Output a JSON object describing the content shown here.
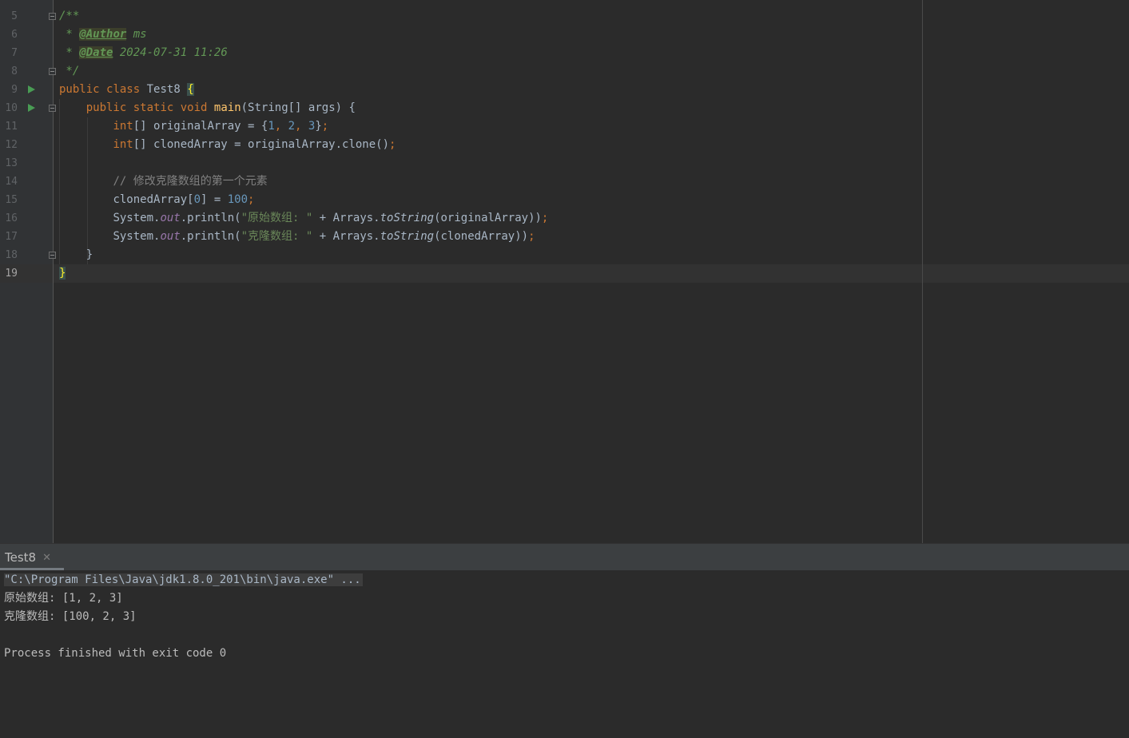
{
  "editor": {
    "line_numbers": [
      "5",
      "6",
      "7",
      "8",
      "9",
      "10",
      "11",
      "12",
      "13",
      "14",
      "15",
      "16",
      "17",
      "18",
      "19"
    ],
    "current_line": "19",
    "javadoc": {
      "open": "/**",
      "star": " * ",
      "author_tag": "@Author",
      "author_value": " ms",
      "date_tag": "@Date",
      "date_value": " 2024-07-31 11:26",
      "close": " */"
    },
    "class_decl": {
      "kw_public": "public",
      "kw_class": "class",
      "name": "Test8",
      "brace": "{"
    },
    "main_decl": {
      "kw_public": "public",
      "kw_static": "static",
      "kw_void": "void",
      "name": "main",
      "params": "(String[] args) {"
    },
    "line11": {
      "type": "int",
      "rest": "[] originalArray = {",
      "n1": "1",
      "c1": ", ",
      "n2": "2",
      "c2": ", ",
      "n3": "3",
      "close": "}",
      "semi": ";"
    },
    "line12": {
      "type": "int",
      "rest": "[] clonedArray = originalArray.clone()",
      "semi": ";"
    },
    "line14_comment": "// 修改克隆数组的第一个元素",
    "line15": {
      "a": "clonedArray[",
      "idx": "0",
      "b": "] = ",
      "val": "100",
      "semi": ";"
    },
    "line16": {
      "sys": "System.",
      "out": "out",
      "call": ".println(",
      "str": "\"原始数组: \"",
      "plus": " + Arrays.",
      "method": "toString",
      "arg": "(originalArray))",
      "semi": ";"
    },
    "line17": {
      "sys": "System.",
      "out": "out",
      "call": ".println(",
      "str": "\"克隆数组: \"",
      "plus": " + Arrays.",
      "method": "toString",
      "arg": "(clonedArray))",
      "semi": ";"
    },
    "line18": "}",
    "line19": "}"
  },
  "run_panel": {
    "tab_label": "Test8",
    "close_symbol": "✕",
    "console": {
      "command": "\"C:\\Program Files\\Java\\jdk1.8.0_201\\bin\\java.exe\" ...",
      "output_1": "原始数组: [1, 2, 3]",
      "output_2": "克隆数组: [100, 2, 3]",
      "exit": "Process finished with exit code 0"
    }
  }
}
